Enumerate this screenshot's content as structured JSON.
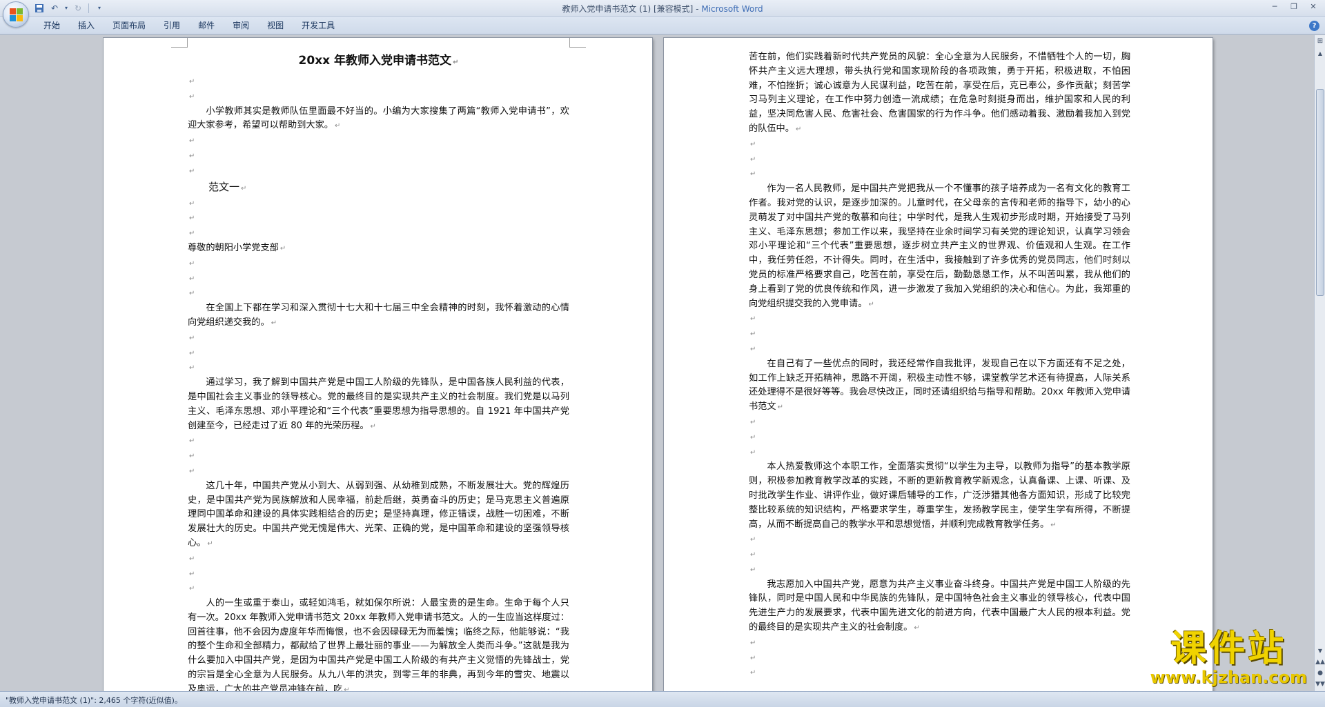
{
  "window": {
    "title_doc": "教师入党申请书范文 (1) [兼容模式]",
    "title_separator": " - ",
    "title_app": "Microsoft Word"
  },
  "ribbon": {
    "tabs": [
      "开始",
      "插入",
      "页面布局",
      "引用",
      "邮件",
      "审阅",
      "视图",
      "开发工具"
    ]
  },
  "document": {
    "left_page": [
      {
        "text": "20xx 年教师入党申请书范文",
        "style": "doc-title"
      },
      {
        "text": "",
        "style": "empty"
      },
      {
        "text": "",
        "style": "empty"
      },
      {
        "text": "小学教师其实是教师队伍里面最不好当的。小编为大家搜集了两篇“教师入党申请书”，欢迎大家参考，希望可以帮助到大家。",
        "style": "indent"
      },
      {
        "text": "",
        "style": "empty"
      },
      {
        "text": "",
        "style": "empty"
      },
      {
        "text": "",
        "style": "empty"
      },
      {
        "text": "范文一",
        "style": "subhead"
      },
      {
        "text": "",
        "style": "empty"
      },
      {
        "text": "",
        "style": "empty"
      },
      {
        "text": "",
        "style": "empty"
      },
      {
        "text": "尊敬的朝阳小学党支部",
        "style": "plain"
      },
      {
        "text": "",
        "style": "empty"
      },
      {
        "text": "",
        "style": "empty"
      },
      {
        "text": "",
        "style": "empty"
      },
      {
        "text": "在全国上下都在学习和深入贯彻十七大和十七届三中全会精神的时刻，我怀着激动的心情向党组织递交我的。",
        "style": "indent"
      },
      {
        "text": "",
        "style": "empty"
      },
      {
        "text": "",
        "style": "empty"
      },
      {
        "text": "",
        "style": "empty"
      },
      {
        "text": "通过学习，我了解到中国共产党是中国工人阶级的先锋队，是中国各族人民利益的代表，是中国社会主义事业的领导核心。党的最终目的是实现共产主义的社会制度。我们党是以马列主义、毛泽东思想、邓小平理论和“三个代表”重要思想为指导思想的。自 1921 年中国共产党创建至今，已经走过了近 80 年的光荣历程。",
        "style": "indent"
      },
      {
        "text": "",
        "style": "empty"
      },
      {
        "text": "",
        "style": "empty"
      },
      {
        "text": "",
        "style": "empty"
      },
      {
        "text": "这几十年，中国共产党从小到大、从弱到强、从幼稚到成熟，不断发展壮大。党的辉煌历史，是中国共产党为民族解放和人民幸福，前赴后继，英勇奋斗的历史；是马克思主义普遍原理同中国革命和建设的具体实践相结合的历史；是坚持真理，修正错误，战胜一切困难，不断发展壮大的历史。中国共产党无愧是伟大、光荣、正确的党，是中国革命和建设的坚强领导核心。",
        "style": "indent"
      },
      {
        "text": "",
        "style": "empty"
      },
      {
        "text": "",
        "style": "empty"
      },
      {
        "text": "",
        "style": "empty"
      },
      {
        "text": "人的一生或重于泰山，或轻如鸿毛，就如保尔所说：人最宝贵的是生命。生命于每个人只有一次。20xx 年教师入党申请书范文 20xx 年教师入党申请书范文。人的一生应当这样度过：回首往事，他不会因为虚度年华而悔恨，也不会因碌碌无为而羞愧；临终之际，他能够说：“我的整个生命和全部精力，都献给了世界上最壮丽的事业——为解放全人类而斗争。”这就是我为什么要加入中国共产党，是因为中国共产党是中国工人阶级的有共产主义觉悟的先锋战士，党的宗旨是全心全意为人民服务。从九八年的洪灾，到零三年的非典，再到今年的雪灾、地震以及奥运，广大的共产党员冲锋在前，吃",
        "style": "indent"
      }
    ],
    "right_page": [
      {
        "text": "苦在前，他们实践着新时代共产党员的风貌：全心全意为人民服务，不惜牺牲个人的一切，胸怀共产主义远大理想，带头执行党和国家现阶段的各项政策，勇于开拓，积极进取，不怕困难，不怕挫折；诚心诚意为人民谋利益，吃苦在前，享受在后，克已奉公，多作贡献；刻苦学习马列主义理论，在工作中努力创造一流成绩；在危急时刻挺身而出，维护国家和人民的利益，坚决同危害人民、危害社会、危害国家的行为作斗争。他们感动着我、激励着我加入到党的队伍中。",
        "style": "plain"
      },
      {
        "text": "",
        "style": "empty"
      },
      {
        "text": "",
        "style": "empty"
      },
      {
        "text": "",
        "style": "empty"
      },
      {
        "text": "作为一名人民教师，是中国共产党把我从一个不懂事的孩子培养成为一名有文化的教育工作者。我对党的认识，是逐步加深的。儿童时代，在父母亲的言传和老师的指导下，幼小的心灵萌发了对中国共产党的敬慕和向往；中学时代，是我人生观初步形成时期，开始接受了马列主义、毛泽东思想；参加工作以来，我坚持在业余时间学习有关党的理论知识，认真学习领会邓小平理论和“三个代表”重要思想，逐步树立共产主义的世界观、价值观和人生观。在工作中，我任劳任怨，不计得失。同时，在生活中，我接触到了许多优秀的党员同志，他们时刻以党员的标准严格要求自己，吃苦在前，享受在后，勤勤恳恳工作，从不叫苦叫累，我从他们的身上看到了党的优良传统和作风，进一步激发了我加入党组织的决心和信心。为此，我郑重的向党组织提交我的入党申请。",
        "style": "indent"
      },
      {
        "text": "",
        "style": "empty"
      },
      {
        "text": "",
        "style": "empty"
      },
      {
        "text": "",
        "style": "empty"
      },
      {
        "text": "在自己有了一些优点的同时，我还经常作自我批评，发现自己在以下方面还有不足之处，如工作上缺乏开拓精神，思路不开阔，积极主动性不够，课堂教学艺术还有待提高，人际关系还处理得不是很好等等。我会尽快改正，同时还请组织给与指导和帮助。20xx 年教师入党申请书范文",
        "style": "indent"
      },
      {
        "text": "",
        "style": "empty"
      },
      {
        "text": "",
        "style": "empty"
      },
      {
        "text": "",
        "style": "empty"
      },
      {
        "text": "本人热爱教师这个本职工作，全面落实贯彻“以学生为主导，以教师为指导”的基本教学原则，积极参加教育教学改革的实践，不断的更新教育教学新观念，认真备课、上课、听课、及时批改学生作业、讲评作业，做好课后辅导的工作，广泛涉猎其他各方面知识，形成了比较完整比较系统的知识结构，严格要求学生，尊重学生，发扬教学民主，使学生学有所得，不断提高，从而不断提高自己的教学水平和思想觉悟，并顺利完成教育教学任务。",
        "style": "indent"
      },
      {
        "text": "",
        "style": "empty"
      },
      {
        "text": "",
        "style": "empty"
      },
      {
        "text": "",
        "style": "empty"
      },
      {
        "text": "我志愿加入中国共产党，愿意为共产主义事业奋斗终身。中国共产党是中国工人阶级的先锋队，同时是中国人民和中华民族的先锋队，是中国特色社会主义事业的领导核心，代表中国先进生产力的发展要求，代表中国先进文化的前进方向，代表中国最广大人民的根本利益。党的最终目的是实现共产主义的社会制度。",
        "style": "indent"
      },
      {
        "text": "",
        "style": "empty"
      },
      {
        "text": "",
        "style": "empty"
      },
      {
        "text": "",
        "style": "empty"
      }
    ]
  },
  "statusbar": {
    "text": "\"教师入党申请书范文 (1)\": 2,465 个字符(近似值)。"
  },
  "watermark": {
    "cn": "课件站",
    "url": "www.kjzhan.com"
  },
  "icons": {
    "paragraph_mark": "↵"
  }
}
